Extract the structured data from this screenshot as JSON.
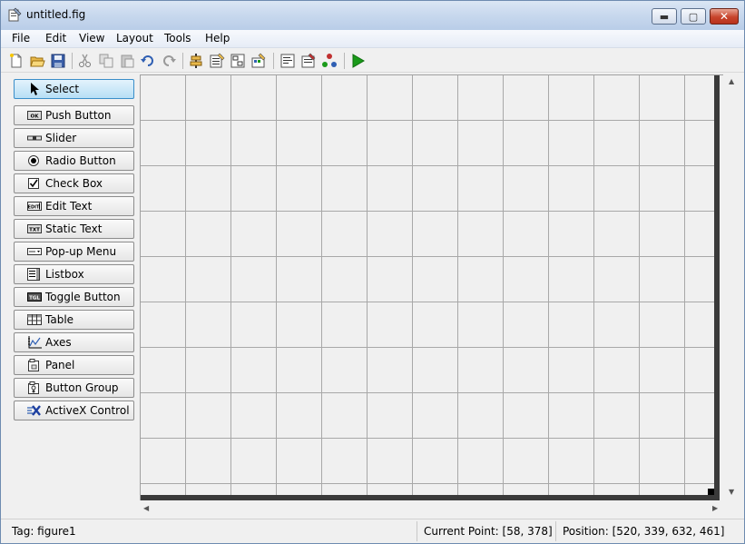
{
  "window": {
    "title": "untitled.fig",
    "minimize_glyph": "▬",
    "maximize_glyph": "▢",
    "close_glyph": "✕"
  },
  "menu": [
    "File",
    "Edit",
    "View",
    "Layout",
    "Tools",
    "Help"
  ],
  "toolbar": {
    "icons": [
      "new-file-icon",
      "open-folder-icon",
      "save-icon",
      "cut-icon",
      "copy-icon",
      "paste-icon",
      "undo-icon",
      "redo-icon",
      "align-objects-icon",
      "menu-editor-icon",
      "tab-order-editor-icon",
      "toolbar-editor-icon",
      "editor-icon",
      "property-inspector-icon",
      "object-browser-icon",
      "run-figure-icon"
    ]
  },
  "palette": {
    "items": [
      {
        "label": "Select",
        "icon": "cursor-arrow-icon",
        "selected": true
      },
      {
        "label": "Push Button",
        "icon": "push-button-icon",
        "badge": "OK"
      },
      {
        "label": "Slider",
        "icon": "slider-icon"
      },
      {
        "label": "Radio Button",
        "icon": "radio-button-icon"
      },
      {
        "label": "Check Box",
        "icon": "check-box-icon"
      },
      {
        "label": "Edit Text",
        "icon": "edit-text-icon",
        "badge": "EDIT"
      },
      {
        "label": "Static Text",
        "icon": "static-text-icon",
        "badge": "TXT"
      },
      {
        "label": "Pop-up Menu",
        "icon": "popup-menu-icon"
      },
      {
        "label": "Listbox",
        "icon": "listbox-icon"
      },
      {
        "label": "Toggle Button",
        "icon": "toggle-button-icon",
        "badge": "TGL"
      },
      {
        "label": "Table",
        "icon": "table-icon"
      },
      {
        "label": "Axes",
        "icon": "axes-icon"
      },
      {
        "label": "Panel",
        "icon": "panel-icon"
      },
      {
        "label": "Button Group",
        "icon": "button-group-icon"
      },
      {
        "label": "ActiveX Control",
        "icon": "activex-control-icon"
      }
    ]
  },
  "status": {
    "tag": "Tag: figure1",
    "current_point": "Current Point:  [58, 378]",
    "position": "Position: [520, 339, 632, 461]"
  },
  "colors": {
    "accent_select": "#b7dff5",
    "run_green": "#1a9a1a",
    "close_red": "#c8442c"
  }
}
